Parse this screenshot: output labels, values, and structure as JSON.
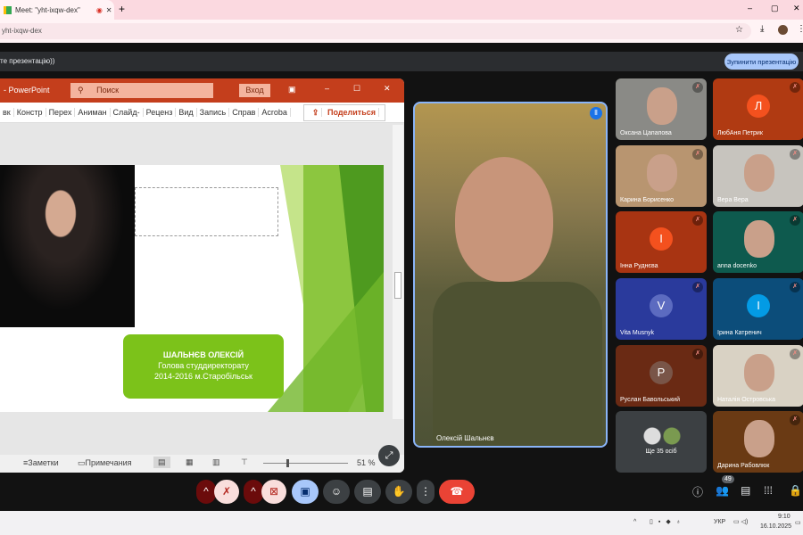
{
  "browser": {
    "tab_title": "Meet: \"yht-ixqw-dex\"",
    "address": "yht-ixqw-dex",
    "window_controls": [
      "–",
      "▢",
      "✕"
    ]
  },
  "banner": {
    "text": "те презентацію))",
    "stop_button": "Зупинити презентацію"
  },
  "powerpoint": {
    "title": "- PowerPoint",
    "search_placeholder": "Поиск",
    "signin": "Вход",
    "ribbon_tabs": [
      "вк",
      "Констр",
      "Перех",
      "Аниман",
      "Слайд-",
      "Реценз",
      "Вид",
      "Запись",
      "Справ",
      "Acroba"
    ],
    "share": "Поделиться",
    "slide": {
      "name": "ШАЛЬНЄВ ОЛЕКСІЙ",
      "line2": "Голова студдиректорату",
      "line3": "2014-2016 м.Старобільськ"
    },
    "status": {
      "notes": "Заметки",
      "comments": "Примечания",
      "zoom": "51 %"
    }
  },
  "main_video": {
    "name": "Олексій Шальнєв"
  },
  "participants": [
    {
      "name": "Оксана Цапапова",
      "type": "video",
      "bg": "#8a8a86"
    },
    {
      "name": "ЛюбАня Петрик",
      "initial": "Л",
      "bg": "#b03a12",
      "avatar": "#f4511e"
    },
    {
      "name": "Карина Борисенко",
      "type": "video",
      "bg": "#b89570"
    },
    {
      "name": "Вера Вера",
      "type": "video",
      "bg": "#c7c4be"
    },
    {
      "name": "Інна Руднєва",
      "initial": "І",
      "bg": "#a83412",
      "avatar": "#f4511e"
    },
    {
      "name": "anna docenko",
      "type": "photo",
      "bg": "#0e5a4e"
    },
    {
      "name": "Vita Musnyk",
      "initial": "V",
      "bg": "#2a3a9c",
      "avatar": "#5c6bc0"
    },
    {
      "name": "Ірина Катренич",
      "initial": "І",
      "bg": "#0c4d7a",
      "avatar": "#039be5"
    },
    {
      "name": "Руслан Бавольський",
      "initial": "Р",
      "bg": "#6a2a14",
      "avatar": "#795548"
    },
    {
      "name": "Наталія Островська",
      "type": "video",
      "bg": "#d9d2c4"
    },
    {
      "name": "Ще 35 осіб",
      "type": "more",
      "bg": "#3c4043"
    },
    {
      "name": "Дарина Рабовлюк",
      "type": "photo",
      "bg": "#6a3a14"
    }
  ],
  "controls": {
    "participants_count": "49"
  },
  "taskbar": {
    "lang": "УКР",
    "time": "9:10",
    "date": "16.10.2025"
  },
  "colors": {
    "ppt_orange": "#c43e1c",
    "end_call": "#ea4335",
    "accent": "#a8c7fa"
  }
}
